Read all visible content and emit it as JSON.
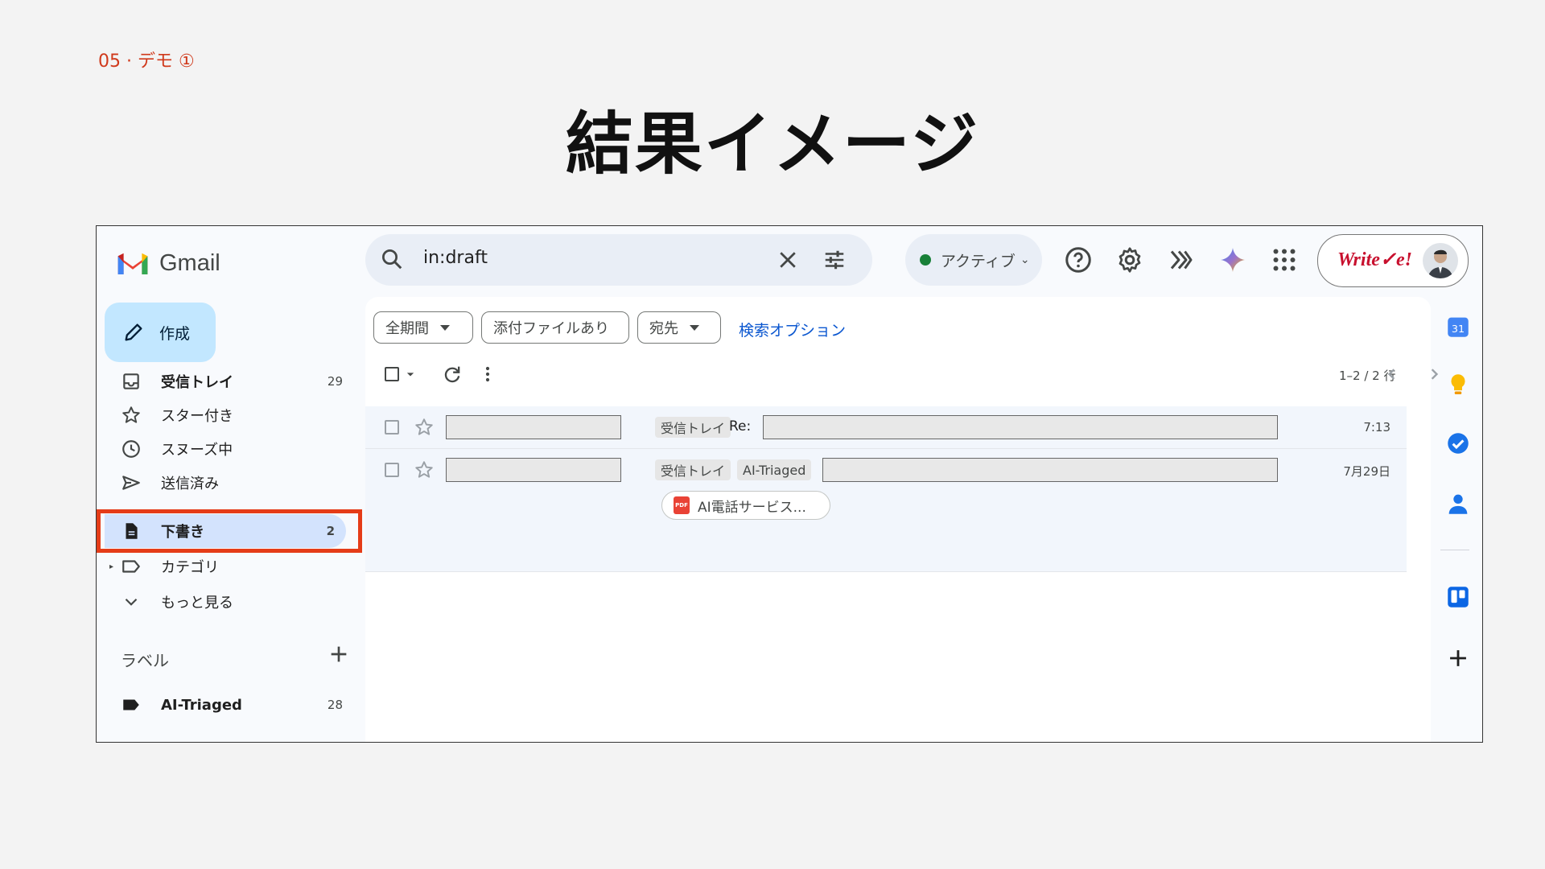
{
  "slide": {
    "label": "05 · デモ ①",
    "title": "結果イメージ"
  },
  "header": {
    "app_name": "Gmail",
    "search_value": "in:draft",
    "status_label": "アクティブ",
    "brand_text": "Write✓e!"
  },
  "compose": {
    "label": "作成"
  },
  "nav": {
    "inbox": {
      "label": "受信トレイ",
      "count": "29"
    },
    "starred": {
      "label": "スター付き"
    },
    "snoozed": {
      "label": "スヌーズ中"
    },
    "sent": {
      "label": "送信済み"
    },
    "drafts": {
      "label": "下書き",
      "count": "2"
    },
    "categories": {
      "label": "カテゴリ"
    },
    "more": {
      "label": "もっと見る"
    }
  },
  "labels": {
    "heading": "ラベル",
    "items": [
      {
        "label": "AI-Triaged",
        "count": "28"
      }
    ]
  },
  "filters": {
    "period": "全期間",
    "attachment": "添付ファイルあり",
    "to": "宛先",
    "advanced": "検索オプション"
  },
  "toolbar": {
    "pager": "1–2 / 2 行"
  },
  "emails": [
    {
      "tags": [
        "受信トレイ"
      ],
      "prefix": "Re:",
      "time": "7:13"
    },
    {
      "tags": [
        "受信トレイ",
        "AI-Triaged"
      ],
      "time": "7月29日",
      "attachment": "AI電話サービス..."
    }
  ],
  "colors": {
    "accent_blue": "#0b57d0",
    "highlight_red": "#e53c18",
    "active_bg": "#d3e3fd",
    "compose_bg": "#c2e7ff"
  }
}
